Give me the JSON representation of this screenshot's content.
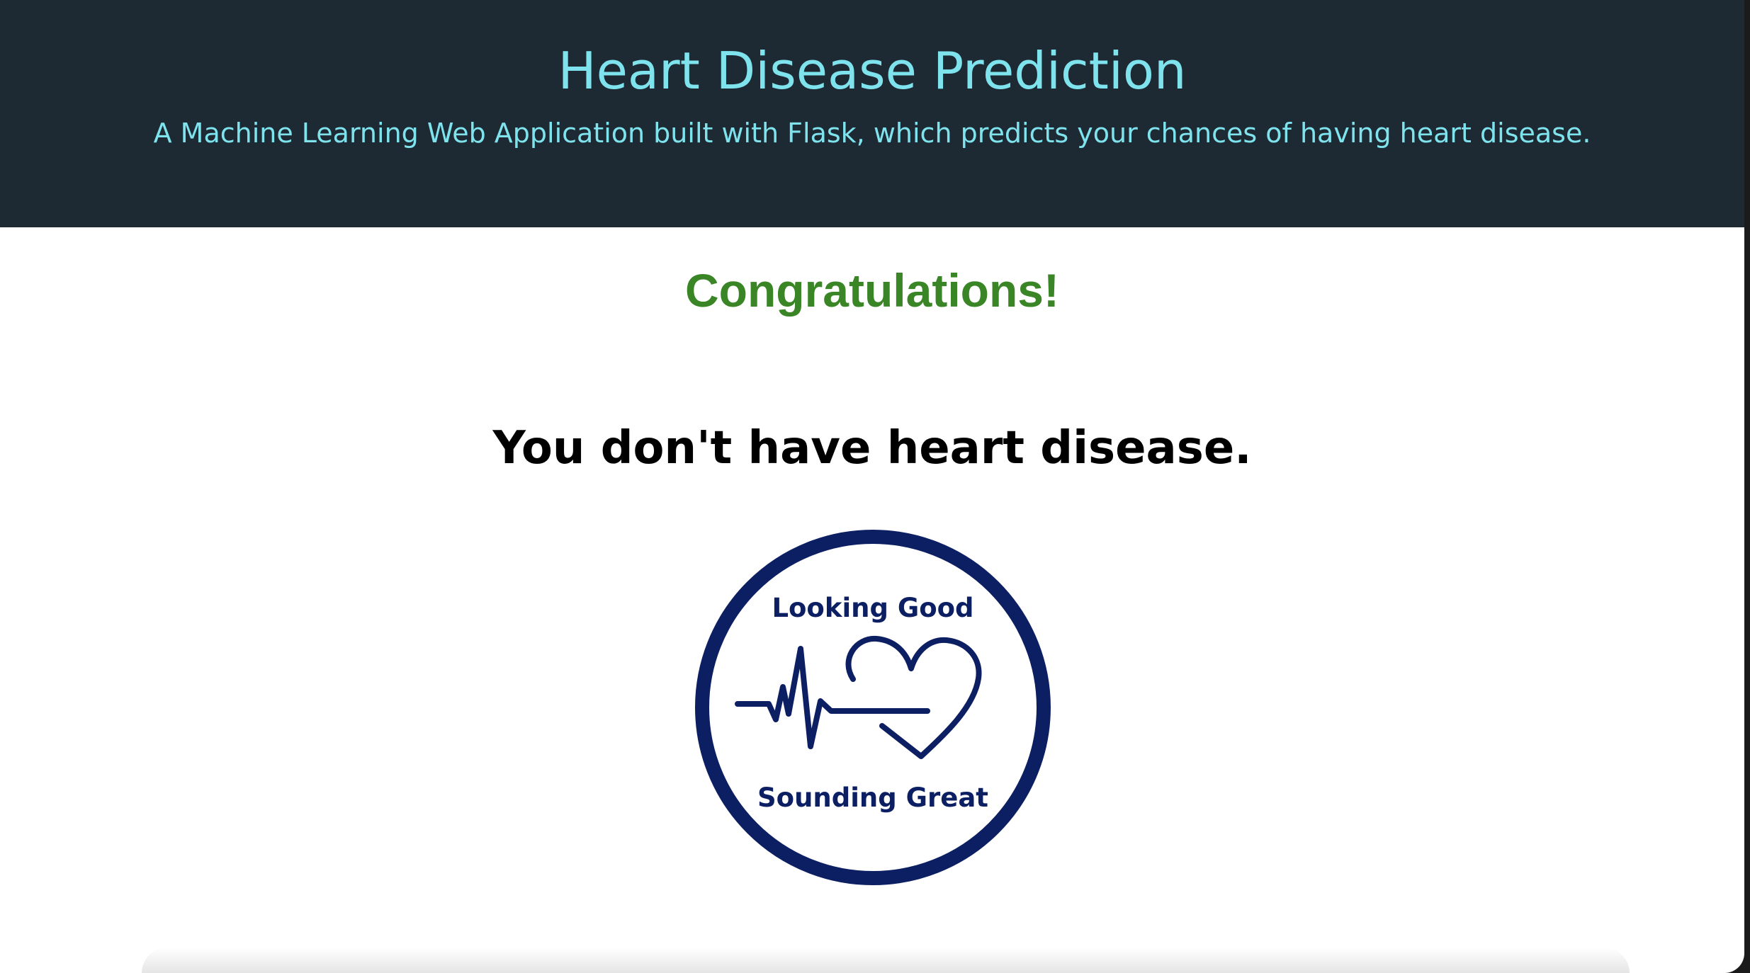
{
  "header": {
    "title": "Heart Disease Prediction",
    "subtitle": "A Machine Learning Web Application built with Flask, which predicts your chances of having heart disease."
  },
  "result": {
    "headline": "Congratulations!",
    "message": "You don't have heart disease."
  },
  "badge": {
    "top_text": "Looking Good",
    "bottom_text": "Sounding Great",
    "icon": "heartbeat-heart-icon"
  },
  "colors": {
    "header_bg": "#1d2a33",
    "header_text": "#7fe3ee",
    "congrats_green": "#3a8526",
    "badge_navy": "#0d1f63"
  }
}
